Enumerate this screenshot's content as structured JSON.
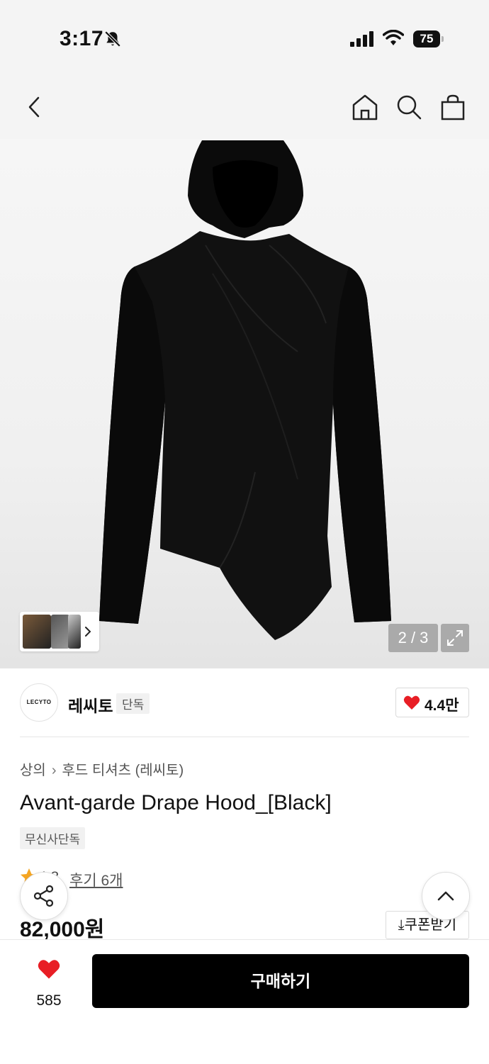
{
  "status_bar": {
    "time": "3:17",
    "battery": "75"
  },
  "gallery": {
    "counter": "2 / 3"
  },
  "brand": {
    "logo_text": "LECYTO",
    "name": "레씨토",
    "tag": "단독",
    "likes": "4.4만"
  },
  "product": {
    "breadcrumb": [
      "상의",
      "후드 티셔츠 (레씨토)"
    ],
    "title": "Avant-garde Drape Hood_[Black]",
    "badge": "무신사단독",
    "rating": "4.8",
    "review_link": "후기 6개",
    "price": "82,000원",
    "coupon_label": "쿠폰받기"
  },
  "bottom_bar": {
    "wish_count": "585",
    "buy_label": "구매하기"
  },
  "colors": {
    "accent": "#e81e25",
    "buy_bg": "#000000",
    "rating_star": "#f5a623"
  }
}
